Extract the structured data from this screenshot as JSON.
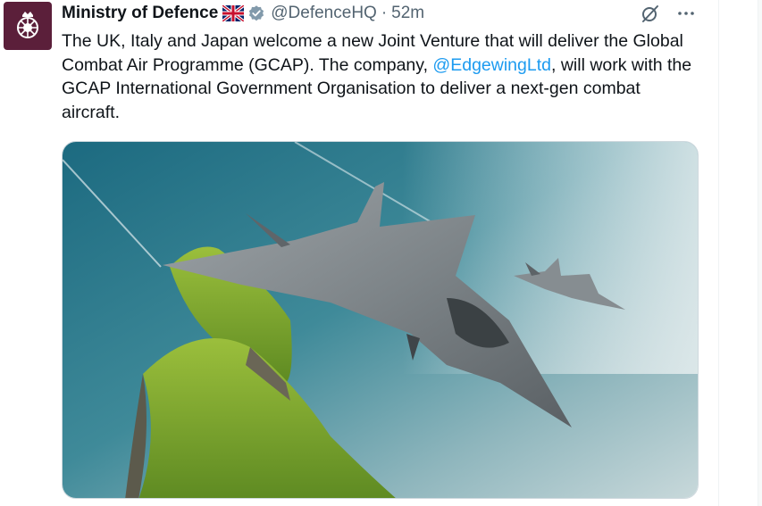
{
  "tweet": {
    "author_name": "Ministry of Defence",
    "flag_icon": "uk-flag-icon",
    "verified_icon": "verified-badge-icon",
    "handle": "@DefenceHQ",
    "separator": "·",
    "time": "52m",
    "text_parts": {
      "before_mention": "The UK, Italy and Japan welcome a new Joint Venture that will deliver the Global Combat Air Programme (GCAP). The company, ",
      "mention": "@EdgewingLtd",
      "after_mention": ", will work with the GCAP International Government Organisation to deliver a next-gen combat aircraft."
    },
    "media_description_icon": "combat-aircraft-photo",
    "actions": {
      "grok_icon": "grok-icon",
      "more_icon": "more-options-icon"
    }
  },
  "colors": {
    "text": "#0f1419",
    "secondary": "#536471",
    "link": "#1d9bf0",
    "avatar_bg": "#5b1f3a"
  }
}
